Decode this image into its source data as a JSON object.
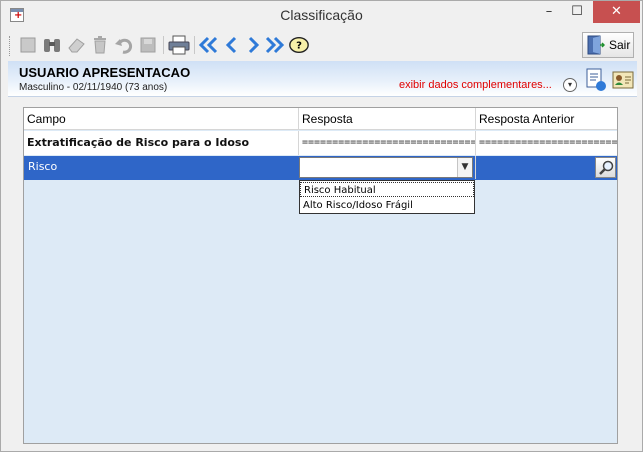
{
  "window": {
    "title": "Classificação",
    "minimize_glyph": "–",
    "maximize_glyph": "☐",
    "close_glyph": "✕"
  },
  "toolbar": {
    "exit_label": "Sair",
    "icons": [
      "new-icon",
      "binoculars-icon",
      "eraser-icon",
      "trash-icon",
      "undo-icon",
      "save-disabled-icon",
      "print-icon",
      "first-icon",
      "prev-icon",
      "next-icon",
      "last-icon",
      "help-icon",
      "exit-door-icon"
    ],
    "accent": "#2f7ad8"
  },
  "patient": {
    "name": "USUARIO APRESENTACAO",
    "info": "Masculino - 02/11/1940 (73 anos)",
    "extra_link": "exibir dados complementares...",
    "toggle_glyph": "▾"
  },
  "grid": {
    "columns": [
      "Campo",
      "Resposta",
      "Resposta Anterior"
    ],
    "section_row": {
      "campo": "Extratificação de Risco para o Idoso",
      "resposta": "================================",
      "anterior": "=========================="
    },
    "selected_row": {
      "campo": "Risco",
      "resposta": "",
      "anterior": ""
    },
    "dropdown_options": [
      "Risco Habitual",
      "Alto Risco/Idoso Frágil"
    ],
    "selection_color": "#2f66c8",
    "grid_bg": "#ddeaf6"
  }
}
